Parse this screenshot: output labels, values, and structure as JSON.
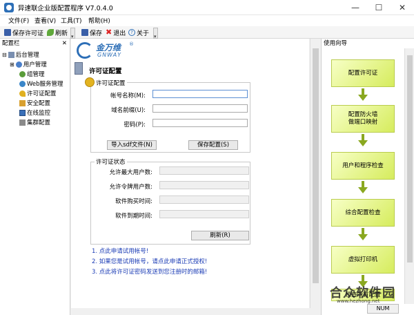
{
  "window": {
    "title": "异速联企业版配置程序 V7.0.4.0",
    "minimize": "—",
    "maximize": "☐",
    "close": "✕"
  },
  "menu": [
    "文件(F)",
    "查看(V)",
    "工具(T)",
    "帮助(H)"
  ],
  "toolbar": {
    "save_license": "保存许可证",
    "refresh": "刷新",
    "save": "保存",
    "exit": "退出",
    "about": "关于"
  },
  "left_panel": {
    "title": "配置栏",
    "close": "✕",
    "tree": [
      {
        "label": "后台管理",
        "expander": "⊟",
        "icon": "server-icon"
      },
      {
        "label": "用户管理",
        "expander": "⊞",
        "icon": "user-icon"
      },
      {
        "label": "组管理",
        "icon": "group-icon"
      },
      {
        "label": "Web服务管理",
        "icon": "web-icon"
      },
      {
        "label": "许可证配置",
        "icon": "key-icon"
      },
      {
        "label": "安全配置",
        "icon": "lock-icon"
      },
      {
        "label": "在线监控",
        "icon": "monitor-icon"
      },
      {
        "label": "集群配置",
        "icon": "cluster-icon"
      }
    ]
  },
  "center": {
    "logo_cn": "金万维",
    "logo_en": "GNWAY",
    "logo_reg": "®",
    "page_title": "许可证配置",
    "license_group": {
      "title": "许可证配置",
      "account_label": "帐号名称(M):",
      "domain_label": "域名前缀(U):",
      "password_label": "密码(P):",
      "import_button": "导入sdf文件(N)",
      "save_button": "保存配置(S)"
    },
    "status_group": {
      "title": "许可证状态",
      "max_users_label": "允许最大用户数:",
      "token_users_label": "允许令牌用户数:",
      "purchase_time_label": "软件购买时间:",
      "expire_time_label": "软件到期时间:",
      "refresh_button": "刷新(R)"
    },
    "links": [
      "1. 点此申请试用帐号!",
      "2. 如果您是试用帐号，请点此申请正式授权!",
      "3. 点此将许可证密码发送到您注册时的邮箱!"
    ]
  },
  "right_panel": {
    "title": "使用向导",
    "close": "✕",
    "steps": [
      "配置许可证",
      "配置防火墙\n做端口映射",
      "用户和程序检查",
      "综合配置检查",
      "虚拟打印机",
      "检查所有配置"
    ]
  },
  "statusbar": {
    "num": "NUM"
  },
  "watermark": {
    "cn": "合众软件园",
    "url": "www.hezhong.net"
  },
  "colors": {
    "accent": "#1a3bb5",
    "flow_green": "#d6ec5d",
    "logo_blue": "#2d6fb7"
  }
}
